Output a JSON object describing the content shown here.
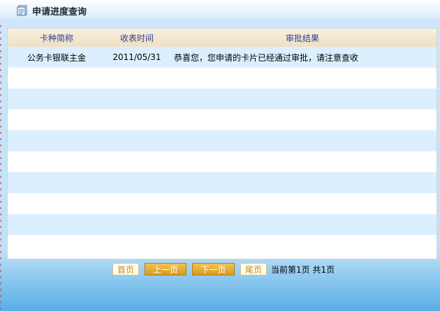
{
  "page": {
    "title": "申请进度查询"
  },
  "table": {
    "headers": [
      "卡种简称",
      "收表时间",
      "审批结果"
    ],
    "rows": [
      [
        "公务卡银联主金",
        "2011/05/31",
        "恭喜您，您申请的卡片已经通过审批，请注意查收"
      ],
      [
        "",
        "",
        ""
      ],
      [
        "",
        "",
        ""
      ],
      [
        "",
        "",
        ""
      ],
      [
        "",
        "",
        ""
      ],
      [
        "",
        "",
        ""
      ],
      [
        "",
        "",
        ""
      ],
      [
        "",
        "",
        ""
      ],
      [
        "",
        "",
        ""
      ],
      [
        "",
        "",
        ""
      ]
    ]
  },
  "pager": {
    "first": "首页",
    "prev": "上一页",
    "next": "下一页",
    "last": "尾页",
    "status": "当前第1页 共1页"
  },
  "icons": {
    "title_icon": "document-icon"
  },
  "colors": {
    "header_text": "#2b3f8f",
    "row_alt": "#dcefff",
    "button_gold": "#e0a52d"
  }
}
